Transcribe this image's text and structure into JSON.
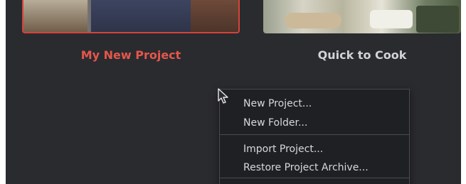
{
  "projects": [
    {
      "name": "My New Project",
      "selected": true
    },
    {
      "name": "Quick to Cook",
      "selected": false
    }
  ],
  "context_menu": {
    "items": [
      {
        "label": "New Project..."
      },
      {
        "label": "New Folder..."
      },
      {
        "label": "Import Project..."
      },
      {
        "label": "Restore Project Archive..."
      }
    ]
  },
  "colors": {
    "selected_accent": "#e5574b",
    "background": "#2a2b2f",
    "menu_background": "#1f2023",
    "text": "#d3d3d6"
  },
  "icons": {
    "cursor": "arrow-cursor-icon"
  }
}
